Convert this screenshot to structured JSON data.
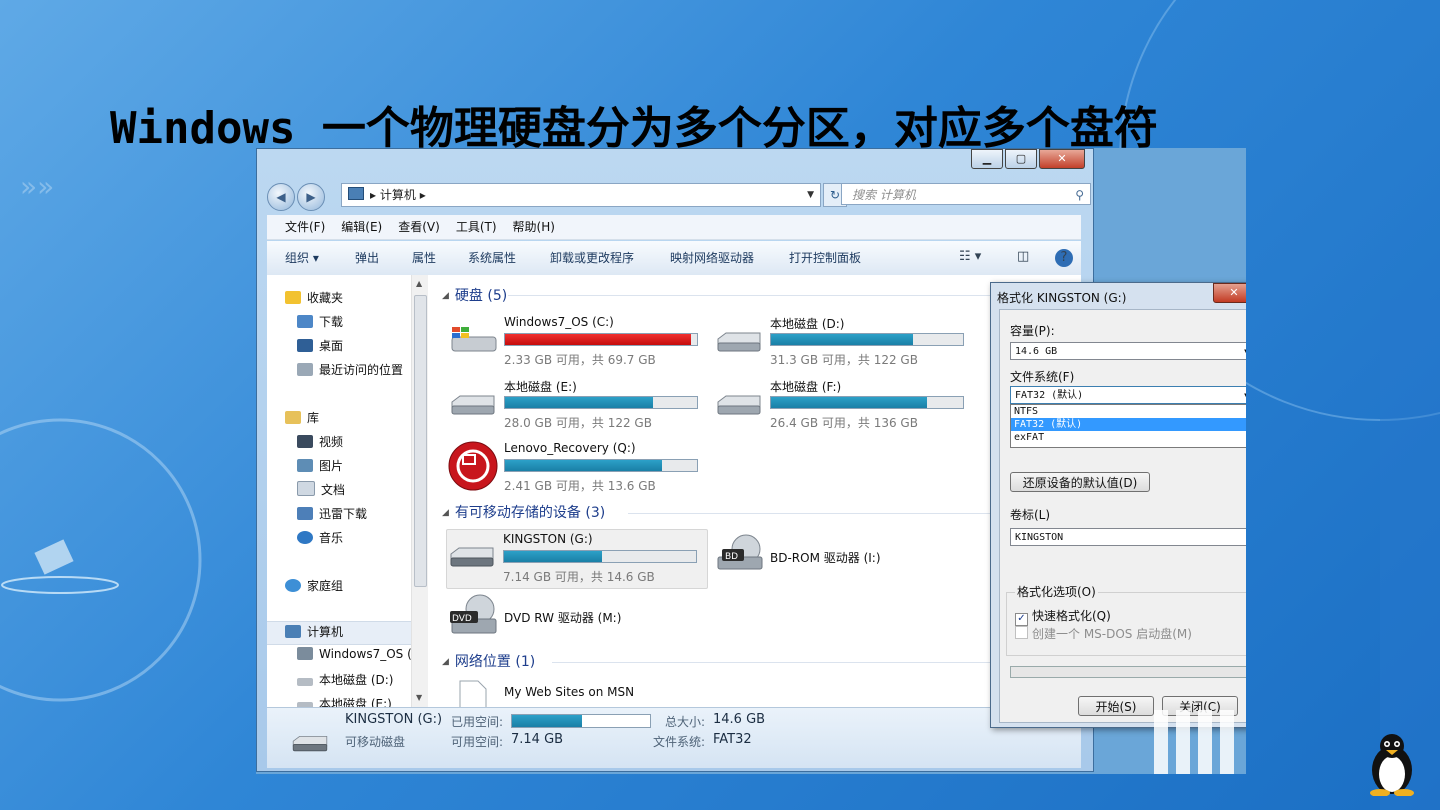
{
  "slide": {
    "title": "Windows 一个物理硬盘分为多个分区，对应多个盘符"
  },
  "explorer": {
    "caption": {
      "minimize": "▁",
      "maximize": "▢",
      "close": "✕"
    },
    "address": {
      "path_root": "▸",
      "path": "计算机",
      "path_sep": "▸"
    },
    "search_placeholder": "搜索 计算机",
    "menu": [
      "文件(F)",
      "编辑(E)",
      "查看(V)",
      "工具(T)",
      "帮助(H)"
    ],
    "commands": [
      "组织 ▾",
      "弹出",
      "属性",
      "系统属性",
      "卸载或更改程序",
      "映射网络驱动器",
      "打开控制面板"
    ],
    "nav": {
      "favorites": "收藏夹",
      "downloads": "下载",
      "desktop": "桌面",
      "recent": "最近访问的位置",
      "libraries": "库",
      "videos": "视频",
      "pictures": "图片",
      "documents": "文档",
      "thunder": "迅雷下载",
      "music": "音乐",
      "homegroup": "家庭组",
      "computer": "计算机",
      "c_drive": "Windows7_OS (",
      "d_drive": "本地磁盘 (D:)",
      "e_drive": "本地磁盘 (E:)"
    },
    "groups": {
      "hdd": "硬盘 (5)",
      "removable": "有可移动存储的设备 (3)",
      "network": "网络位置 (1)"
    },
    "drives": [
      {
        "name": "Windows7_OS (C:)",
        "free": "2.33 GB 可用，共 69.7 GB",
        "used_fraction": 0.967,
        "color": "#d9181a"
      },
      {
        "name": "本地磁盘 (D:)",
        "free": "31.3 GB 可用，共 122 GB",
        "used_fraction": 0.74,
        "color": "#1f8db6"
      },
      {
        "name": "本地磁盘 (E:)",
        "free": "28.0 GB 可用，共 122 GB",
        "used_fraction": 0.77,
        "color": "#1f8db6"
      },
      {
        "name": "本地磁盘 (F:)",
        "free": "26.4 GB 可用，共 136 GB",
        "used_fraction": 0.81,
        "color": "#1f8db6"
      },
      {
        "name": "Lenovo_Recovery (Q:)",
        "free": "2.41 GB 可用，共 13.6 GB",
        "used_fraction": 0.82,
        "color": "#1f8db6"
      }
    ],
    "removable": [
      {
        "name": "KINGSTON (G:)",
        "free": "7.14 GB 可用，共 14.6 GB",
        "used_fraction": 0.51
      },
      {
        "name": "BD-ROM 驱动器 (I:)",
        "badge": "BD"
      },
      {
        "name": "DVD RW 驱动器 (M:)",
        "badge": "DVD"
      }
    ],
    "network": [
      {
        "name": "My Web Sites on MSN"
      }
    ],
    "details": {
      "name": "KINGSTON (G:)",
      "used_label": "已用空间:",
      "type": "可移动磁盘",
      "free_label": "可用空间:",
      "free_value": "7.14 GB",
      "total_label": "总大小:",
      "total_value": "14.6 GB",
      "fs_label": "文件系统:",
      "fs_value": "FAT32",
      "used_fraction": 0.51
    }
  },
  "format_dialog": {
    "title": "格式化 KINGSTON (G:)",
    "close": "✕",
    "capacity_label": "容量(P):",
    "capacity_value": "14.6 GB",
    "fs_label": "文件系统(F)",
    "fs_value": "FAT32 (默认)",
    "fs_options": [
      "NTFS",
      "FAT32 (默认)",
      "exFAT"
    ],
    "restore_button": "还原设备的默认值(D)",
    "volume_label": "卷标(L)",
    "volume_value": "KINGSTON",
    "options_title": "格式化选项(O)",
    "quick_format": "快速格式化(Q)",
    "msdos": "创建一个 MS-DOS 启动盘(M)",
    "start_button": "开始(S)",
    "close_button": "关闭(C)"
  }
}
